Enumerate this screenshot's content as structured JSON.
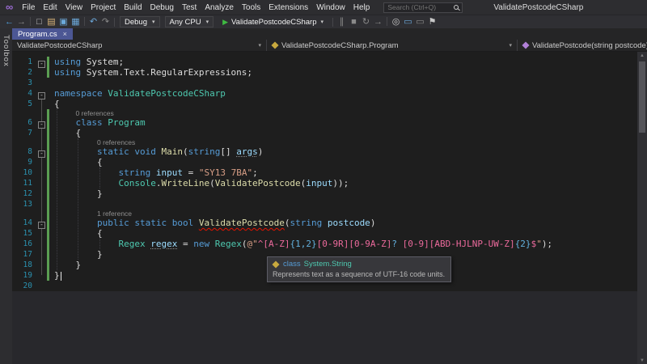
{
  "window": {
    "title": "ValidatePostcodeCSharp"
  },
  "menubar": {
    "items": [
      "File",
      "Edit",
      "View",
      "Project",
      "Build",
      "Debug",
      "Test",
      "Analyze",
      "Tools",
      "Extensions",
      "Window",
      "Help"
    ]
  },
  "search": {
    "placeholder": "Search (Ctrl+Q)"
  },
  "toolbar": {
    "debug_config": "Debug",
    "platform": "Any CPU",
    "run_label": "ValidatePostcodeCSharp",
    "groups_a": [
      [
        {
          "name": "back-arrow-icon",
          "glyph": "←",
          "color": "#4FA3E3"
        },
        {
          "name": "forward-arrow-icon",
          "glyph": "→",
          "color": "#8A8A8A"
        }
      ],
      [
        {
          "name": "new-project-icon",
          "glyph": "□",
          "color": "#C8C8C8"
        },
        {
          "name": "open-file-icon",
          "glyph": "▤",
          "color": "#DCB67A"
        },
        {
          "name": "save-icon",
          "glyph": "▣",
          "color": "#6CA9DB"
        },
        {
          "name": "save-all-icon",
          "glyph": "▦",
          "color": "#6CA9DB"
        }
      ],
      [
        {
          "name": "undo-icon",
          "glyph": "↶",
          "color": "#6CA9DB"
        },
        {
          "name": "redo-icon",
          "glyph": "↷",
          "color": "#8A8A8A"
        }
      ]
    ],
    "groups_b": [
      [
        {
          "name": "break-all-icon",
          "glyph": "∥",
          "color": "#8A8A8A"
        },
        {
          "name": "stop-icon",
          "glyph": "■",
          "color": "#8A8A8A"
        },
        {
          "name": "restart-icon",
          "glyph": "↻",
          "color": "#8A8A8A"
        },
        {
          "name": "show-next-statement-icon",
          "glyph": "→",
          "color": "#8A8A8A"
        }
      ],
      [
        {
          "name": "find-icon",
          "glyph": "◎",
          "color": "#C8C8C8"
        },
        {
          "name": "comment-icon",
          "glyph": "▭",
          "color": "#6CA9DB"
        },
        {
          "name": "uncomment-icon",
          "glyph": "▭",
          "color": "#8A8A8A"
        },
        {
          "name": "bookmark-icon",
          "glyph": "⚑",
          "color": "#C8C8C8"
        }
      ]
    ]
  },
  "tabbar": {
    "tabs": [
      {
        "label": "Program.cs",
        "active": true
      }
    ]
  },
  "navbar": {
    "project": "ValidatePostcodeCSharp",
    "type": "ValidatePostcodeCSharp.Program",
    "member": "ValidatePostcode(string postcode)"
  },
  "toolbox": {
    "label": "Toolbox"
  },
  "editor": {
    "rows": [
      {
        "line": "1",
        "fold": true,
        "changed": true,
        "segs": [
          [
            "kw",
            "using"
          ],
          [
            "pl",
            " System;"
          ]
        ]
      },
      {
        "line": "2",
        "changed": true,
        "segs": [
          [
            "kw",
            "using"
          ],
          [
            "pl",
            " System.Text.RegularExpressions;"
          ]
        ]
      },
      {
        "line": "3",
        "segs": []
      },
      {
        "line": "4",
        "fold": true,
        "segs": [
          [
            "kw",
            "namespace"
          ],
          [
            "pl",
            " "
          ],
          [
            "type",
            "ValidatePostcodeCSharp"
          ]
        ]
      },
      {
        "line": "5",
        "segs": [
          [
            "pl",
            "{"
          ]
        ]
      },
      {
        "kind": "lens",
        "indent": 4,
        "changed": true,
        "text": "0 references"
      },
      {
        "line": "6",
        "fold": true,
        "changed": true,
        "segs": [
          [
            "pl",
            "    "
          ],
          [
            "kw",
            "class"
          ],
          [
            "pl",
            " "
          ],
          [
            "type",
            "Program"
          ]
        ]
      },
      {
        "line": "7",
        "changed": true,
        "segs": [
          [
            "pl",
            "    {"
          ]
        ]
      },
      {
        "kind": "lens",
        "indent": 8,
        "changed": true,
        "text": "0 references"
      },
      {
        "line": "8",
        "fold": true,
        "changed": true,
        "segs": [
          [
            "pl",
            "        "
          ],
          [
            "kw",
            "static"
          ],
          [
            "pl",
            " "
          ],
          [
            "kw",
            "void"
          ],
          [
            "pl",
            " "
          ],
          [
            "m",
            "Main"
          ],
          [
            "pl",
            "("
          ],
          [
            "kw",
            "string"
          ],
          [
            "pl",
            "[] "
          ],
          [
            "param-u",
            "args"
          ],
          [
            "pl",
            ")"
          ]
        ]
      },
      {
        "line": "9",
        "changed": true,
        "segs": [
          [
            "pl",
            "        {"
          ]
        ]
      },
      {
        "line": "10",
        "changed": true,
        "segs": [
          [
            "pl",
            "            "
          ],
          [
            "kw",
            "string"
          ],
          [
            "pl",
            " "
          ],
          [
            "loc",
            "input"
          ],
          [
            "pl",
            " = "
          ],
          [
            "str",
            "\"SY13 7BA\""
          ],
          [
            "pl",
            ";"
          ]
        ]
      },
      {
        "line": "11",
        "changed": true,
        "segs": [
          [
            "pl",
            "            "
          ],
          [
            "type",
            "Console"
          ],
          [
            "pl",
            "."
          ],
          [
            "m",
            "WriteLine"
          ],
          [
            "pl",
            "("
          ],
          [
            "m",
            "ValidatePostcode"
          ],
          [
            "pl",
            "("
          ],
          [
            "loc",
            "input"
          ],
          [
            "pl",
            "));"
          ]
        ]
      },
      {
        "line": "12",
        "changed": true,
        "segs": [
          [
            "pl",
            "        }"
          ]
        ]
      },
      {
        "line": "13",
        "changed": true,
        "segs": []
      },
      {
        "kind": "lens",
        "indent": 8,
        "changed": true,
        "text": "1 reference"
      },
      {
        "line": "14",
        "fold": true,
        "changed": true,
        "segs": [
          [
            "pl",
            "        "
          ],
          [
            "kw",
            "public"
          ],
          [
            "pl",
            " "
          ],
          [
            "kw",
            "static"
          ],
          [
            "pl",
            " "
          ],
          [
            "kw",
            "bool"
          ],
          [
            "pl",
            " "
          ],
          [
            "m-err",
            "ValidatePostcode"
          ],
          [
            "pl",
            "("
          ],
          [
            "kw",
            "string"
          ],
          [
            "pl",
            " "
          ],
          [
            "param",
            "postcode"
          ],
          [
            "pl",
            ")"
          ]
        ]
      },
      {
        "line": "15",
        "changed": true,
        "segs": [
          [
            "pl",
            "        {"
          ]
        ]
      },
      {
        "line": "16",
        "changed": true,
        "segs": [
          [
            "pl",
            "            "
          ],
          [
            "type",
            "Regex"
          ],
          [
            "pl",
            " "
          ],
          [
            "loc-u",
            "regex"
          ],
          [
            "pl",
            " = "
          ],
          [
            "kw",
            "new"
          ],
          [
            "pl",
            " "
          ],
          [
            "type",
            "Regex"
          ],
          [
            "pl",
            "("
          ],
          [
            "str",
            "@\""
          ],
          [
            "rxa",
            "^"
          ],
          [
            "rxc",
            "[A-Z]"
          ],
          [
            "rxq",
            "{1,2}"
          ],
          [
            "rxc",
            "[0-9R]"
          ],
          [
            "rxc",
            "[0-9A-Z]"
          ],
          [
            "rxq",
            "?"
          ],
          [
            "str",
            " "
          ],
          [
            "rxc",
            "[0-9]"
          ],
          [
            "rxc",
            "[ABD-HJLNP-UW-Z]"
          ],
          [
            "rxq",
            "{2}"
          ],
          [
            "rxa",
            "$"
          ],
          [
            "str",
            "\""
          ],
          [
            "pl",
            ");"
          ]
        ]
      },
      {
        "line": "17",
        "changed": true,
        "segs": [
          [
            "pl",
            "        }"
          ]
        ]
      },
      {
        "line": "18",
        "changed": true,
        "segs": [
          [
            "pl",
            "    }"
          ]
        ]
      },
      {
        "line": "19",
        "changed": true,
        "caret": true,
        "segs": [
          [
            "pl",
            "}"
          ]
        ]
      },
      {
        "line": "20",
        "segs": []
      }
    ]
  },
  "tooltip": {
    "keyword": "class",
    "type_name": "System.String",
    "description": "Represents text as a sequence of UTF-16 code units."
  }
}
